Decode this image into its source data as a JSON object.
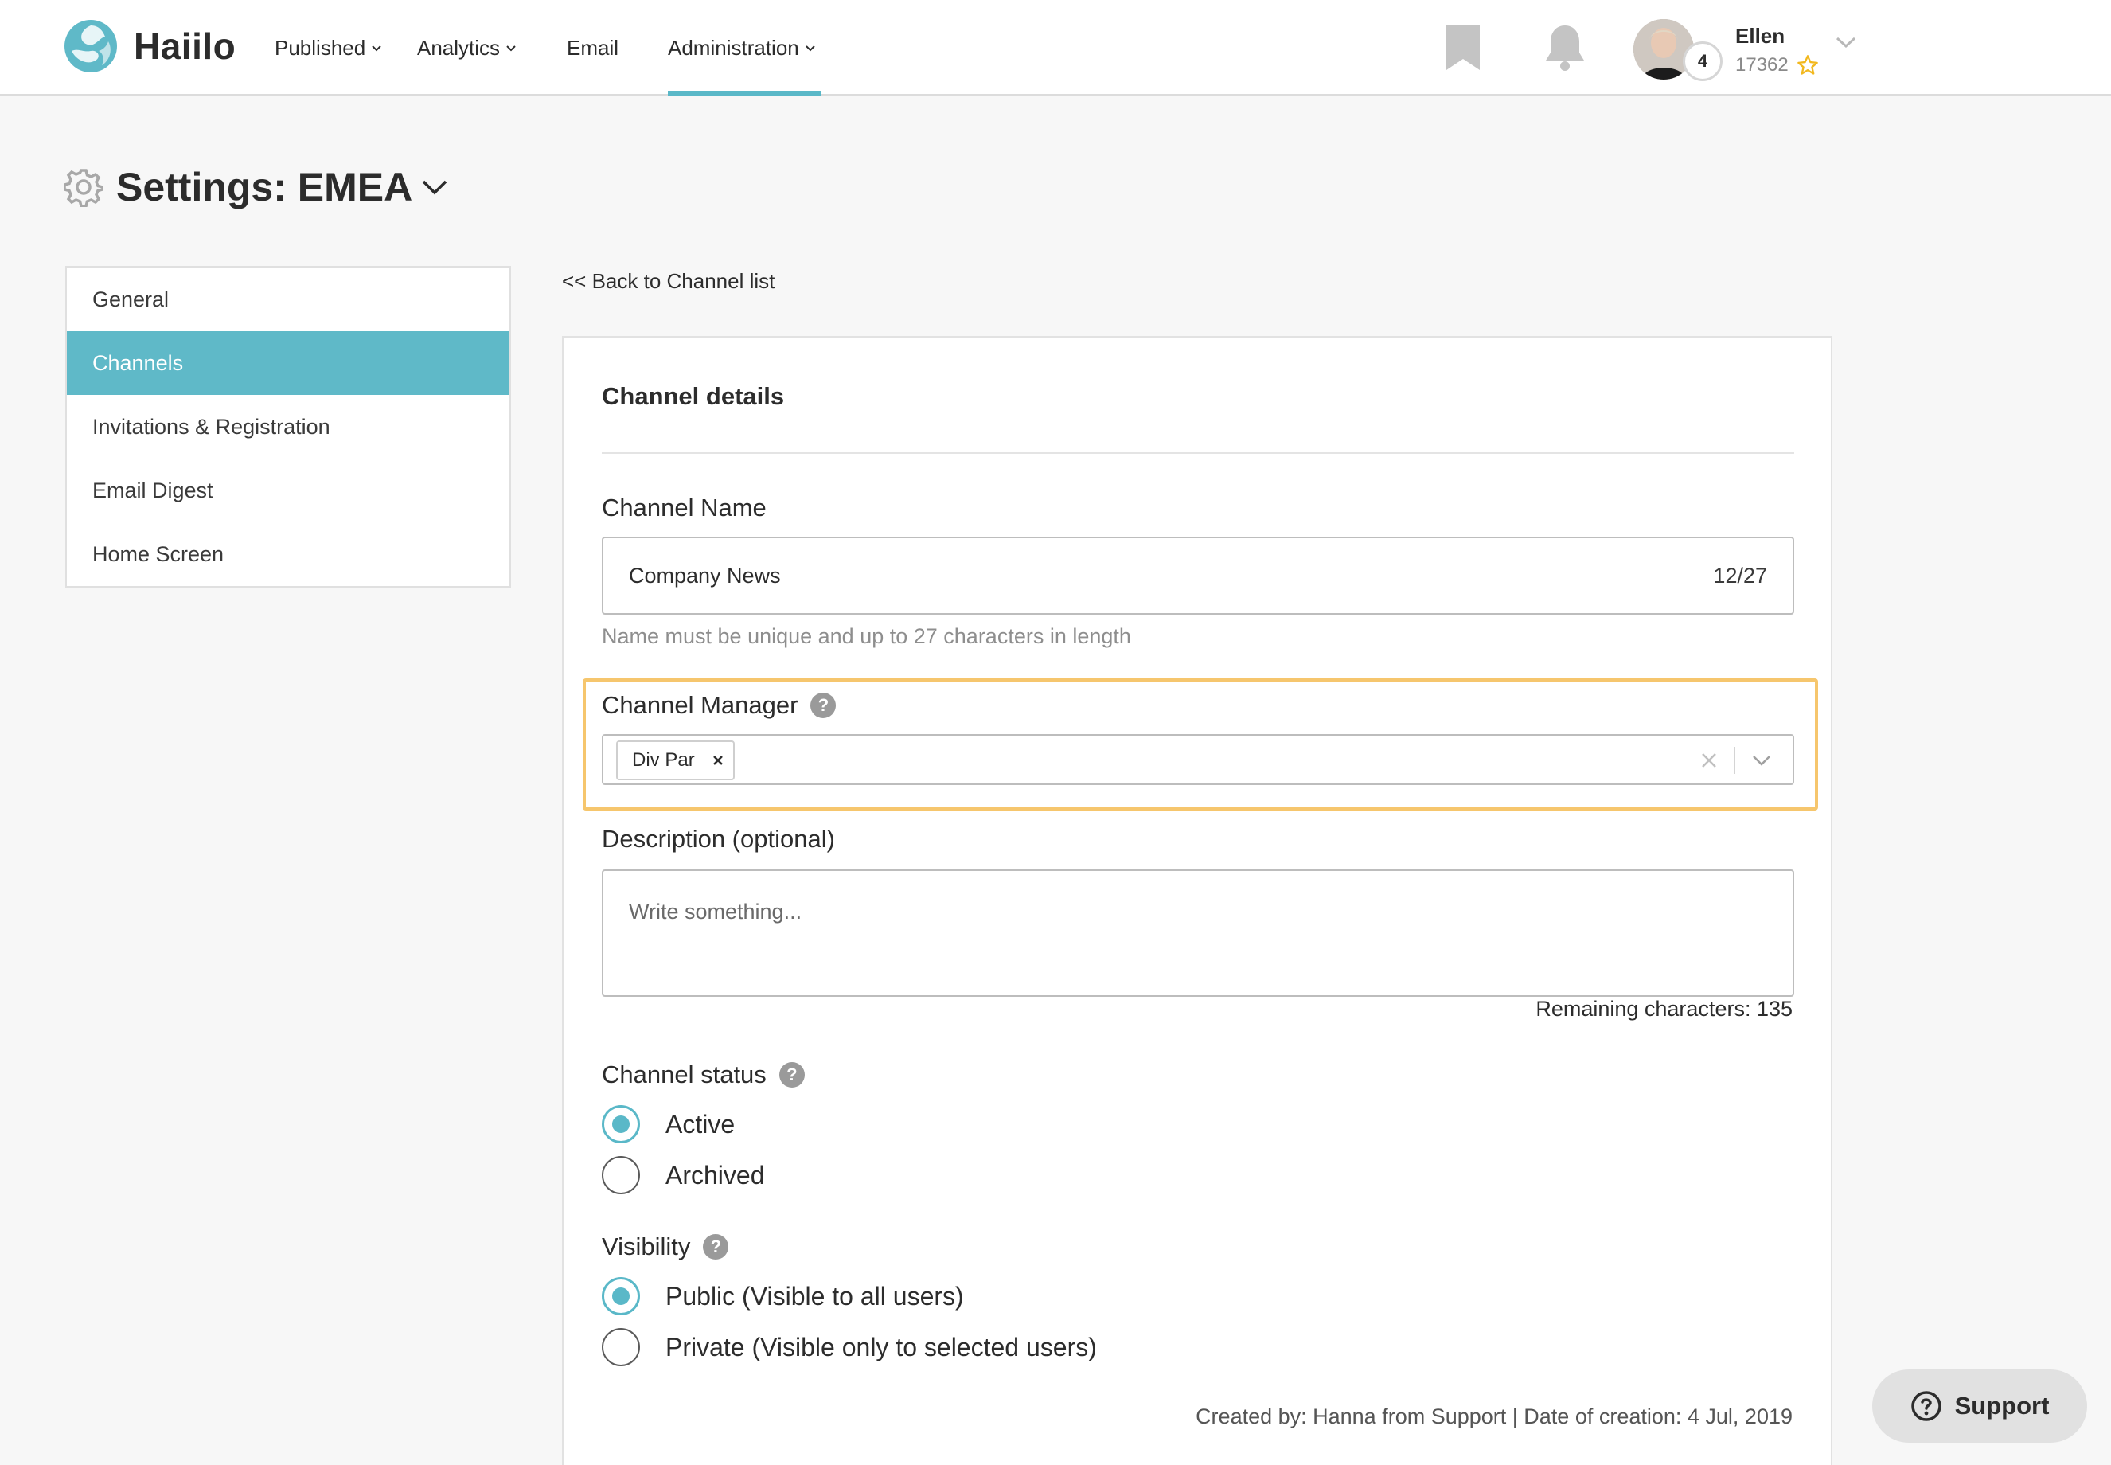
{
  "app": {
    "brand": "Haiilo"
  },
  "nav": {
    "published": "Published",
    "analytics": "Analytics",
    "email": "Email",
    "administration": "Administration"
  },
  "user": {
    "name": "Ellen",
    "points": "17362",
    "level": "4"
  },
  "page": {
    "title": "Settings: EMEA"
  },
  "sidebar": {
    "items": [
      {
        "label": "General"
      },
      {
        "label": "Channels"
      },
      {
        "label": "Invitations & Registration"
      },
      {
        "label": "Email Digest"
      },
      {
        "label": "Home Screen"
      }
    ],
    "active": "Channels"
  },
  "main": {
    "back_link": "<< Back to Channel list",
    "panel_title": "Channel details",
    "channel_name": {
      "label": "Channel Name",
      "value": "Company News",
      "counter": "12/27",
      "hint": "Name must be unique and up to 27 characters in length"
    },
    "channel_manager": {
      "label": "Channel Manager",
      "selected": [
        "Div Par"
      ]
    },
    "description": {
      "label": "Description (optional)",
      "placeholder": "Write something...",
      "remaining": "Remaining characters: 135"
    },
    "channel_status": {
      "label": "Channel status",
      "options": [
        "Active",
        "Archived"
      ],
      "selected": "Active"
    },
    "visibility": {
      "label": "Visibility",
      "options": [
        "Public (Visible to all users)",
        "Private (Visible only to selected users)"
      ],
      "selected": "Public (Visible to all users)"
    },
    "created": "Created by: Hanna from Support | Date of creation: 4 Jul, 2019"
  },
  "support": {
    "label": "Support"
  },
  "colors": {
    "accent": "#5ab8c8",
    "highlight": "#f6c66d",
    "star": "#f2b81e"
  }
}
